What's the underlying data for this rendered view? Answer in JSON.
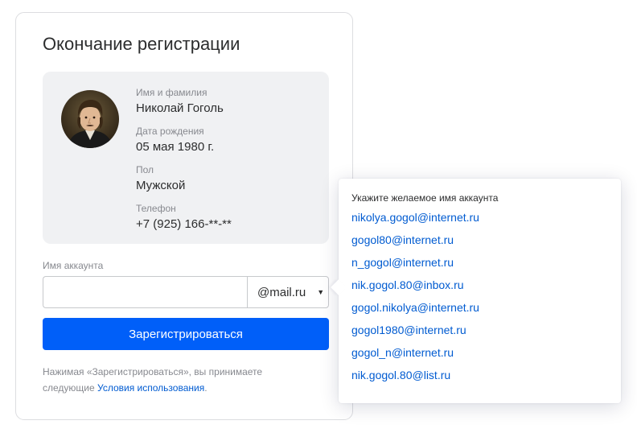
{
  "form": {
    "title": "Окончание регистрации",
    "profile": {
      "name_label": "Имя и фамилия",
      "name_value": "Николай Гоголь",
      "birth_label": "Дата рождения",
      "birth_value": "05 мая 1980 г.",
      "gender_label": "Пол",
      "gender_value": "Мужской",
      "phone_label": "Телефон",
      "phone_value": "+7 (925) 166-**-**"
    },
    "account_label": "Имя аккаунта",
    "account_value": "",
    "domain_selected": "@mail.ru",
    "submit_label": "Зарегистрироваться",
    "terms_text": "Нажимая «Зарегистрироваться», вы принимаете следующие ",
    "terms_link": "Условия использования",
    "terms_end": "."
  },
  "suggestions": {
    "title": "Укажите желаемое имя аккаунта",
    "items": [
      "nikolya.gogol@internet.ru",
      "gogol80@internet.ru",
      "n_gogol@internet.ru",
      "nik.gogol.80@inbox.ru",
      "gogol.nikolya@internet.ru",
      "gogol1980@internet.ru",
      "gogol_n@internet.ru",
      "nik.gogol.80@list.ru"
    ]
  },
  "colors": {
    "primary": "#005ff9",
    "link": "#005bd1",
    "muted": "#87898f",
    "panel": "#f0f1f3"
  },
  "icons": {
    "dropdown": "chevron-down-icon",
    "avatar": "portrait-avatar"
  }
}
